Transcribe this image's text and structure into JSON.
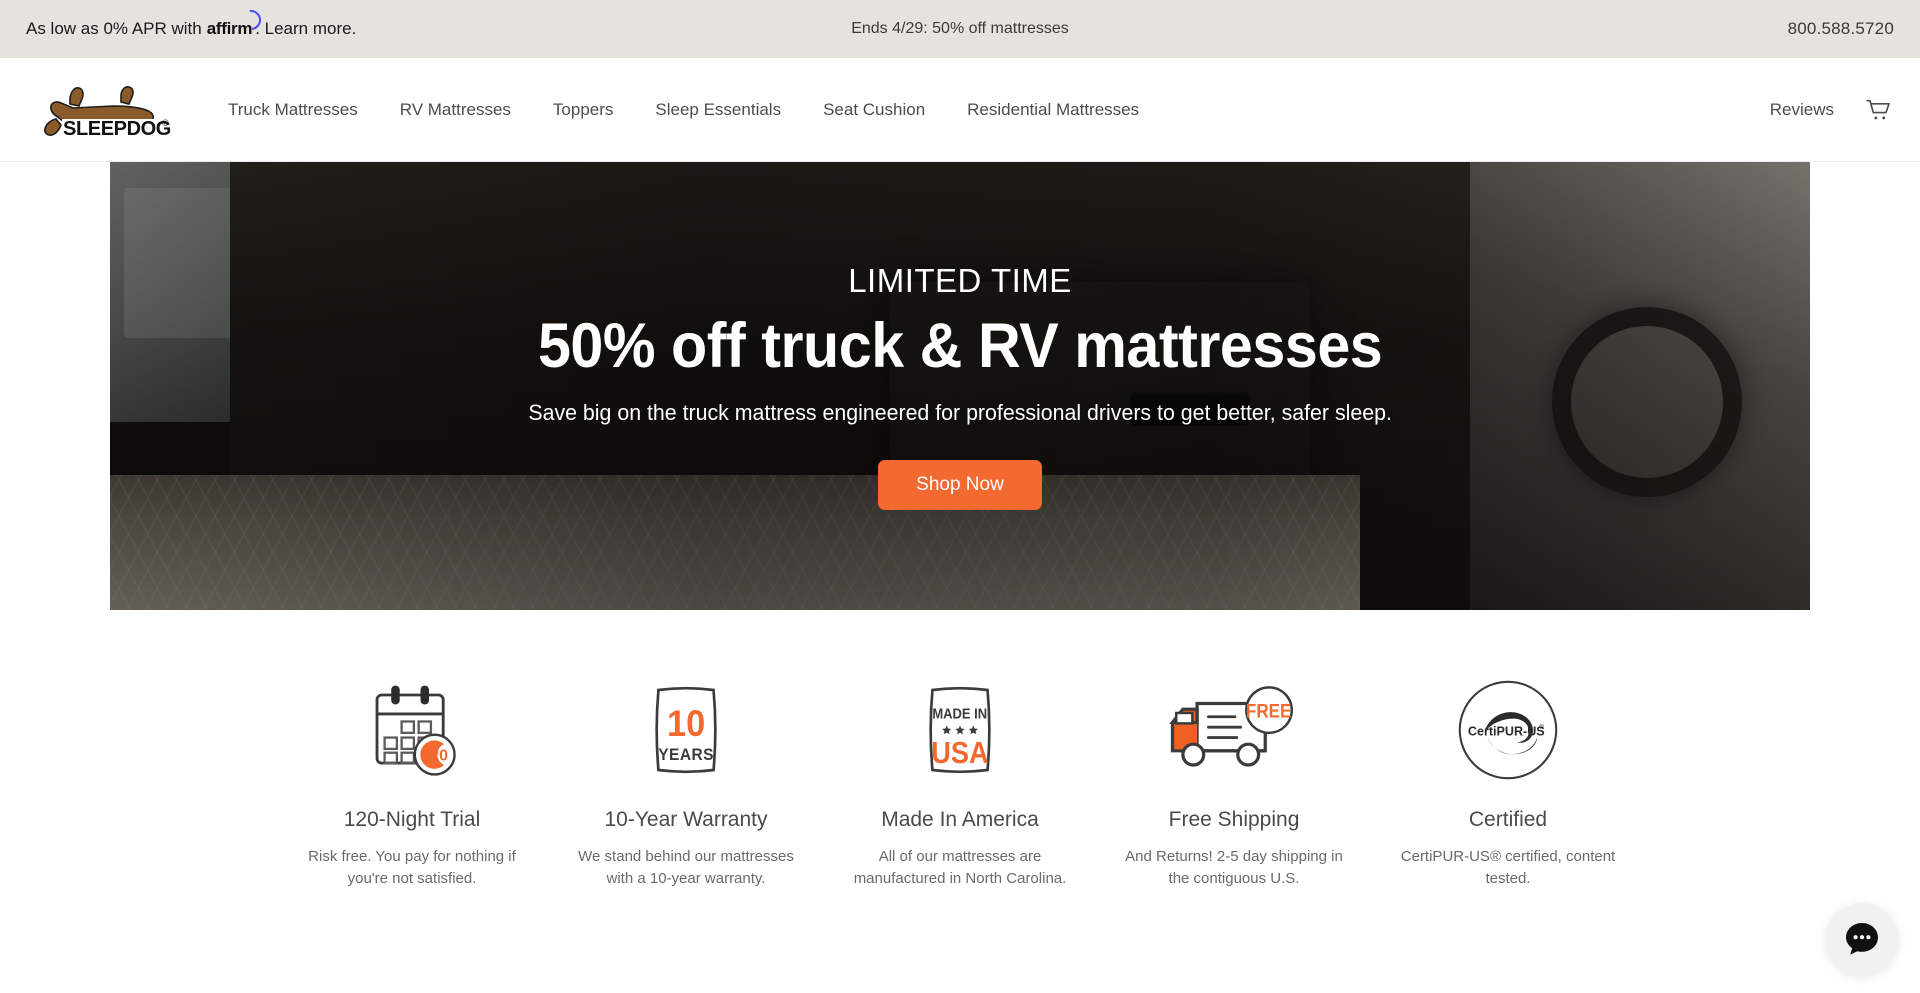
{
  "announcement": {
    "affirm_prefix": "As low as 0% APR with",
    "affirm_brand": "affirm",
    "affirm_suffix": ". Learn more.",
    "center_text": "Ends 4/29: 50% off mattresses",
    "phone": "800.588.5720"
  },
  "header": {
    "logo_text": "SLEEPDOG",
    "logo_registered": "®",
    "nav": [
      {
        "label": "Truck Mattresses"
      },
      {
        "label": "RV Mattresses"
      },
      {
        "label": "Toppers"
      },
      {
        "label": "Sleep Essentials"
      },
      {
        "label": "Seat Cushion"
      },
      {
        "label": "Residential Mattresses"
      }
    ],
    "reviews_label": "Reviews",
    "cart_icon": "shopping-cart-icon"
  },
  "hero": {
    "eyebrow": "LIMITED TIME",
    "title": "50% off truck & RV mattresses",
    "subtitle": "Save big on the truck mattress engineered for professional drivers to get better, safer sleep.",
    "cta_label": "Shop Now"
  },
  "badges": [
    {
      "icon": "calendar-120-nights-icon",
      "title": "120-Night Trial",
      "desc": "Risk free. You pay for nothing if you're not satisfied.",
      "badge_number": "120"
    },
    {
      "icon": "ten-year-warranty-icon",
      "title": "10-Year Warranty",
      "desc": "We stand behind our mattresses with a 10-year warranty.",
      "icon_top": "10",
      "icon_bottom": "YEARS"
    },
    {
      "icon": "made-in-usa-icon",
      "title": "Made In America",
      "desc": "All of our mattresses are manufactured in North Carolina.",
      "icon_top": "MADE IN",
      "icon_bottom": "USA"
    },
    {
      "icon": "free-shipping-truck-icon",
      "title": "Free Shipping",
      "desc": "And Returns! 2-5 day shipping in the contiguous U.S.",
      "icon_label": "FREE"
    },
    {
      "icon": "certipur-us-icon",
      "title": "Certified",
      "desc": "CertiPUR-US® certified, content tested.",
      "icon_label": "CertiPUR-US"
    }
  ],
  "chat": {
    "icon": "chat-bubble-icon"
  },
  "colors": {
    "accent_orange": "#f4692f",
    "announce_bg": "#e6e3df",
    "affirm_purple": "#4a4af4",
    "logo_brown": "#8a5a2b"
  }
}
